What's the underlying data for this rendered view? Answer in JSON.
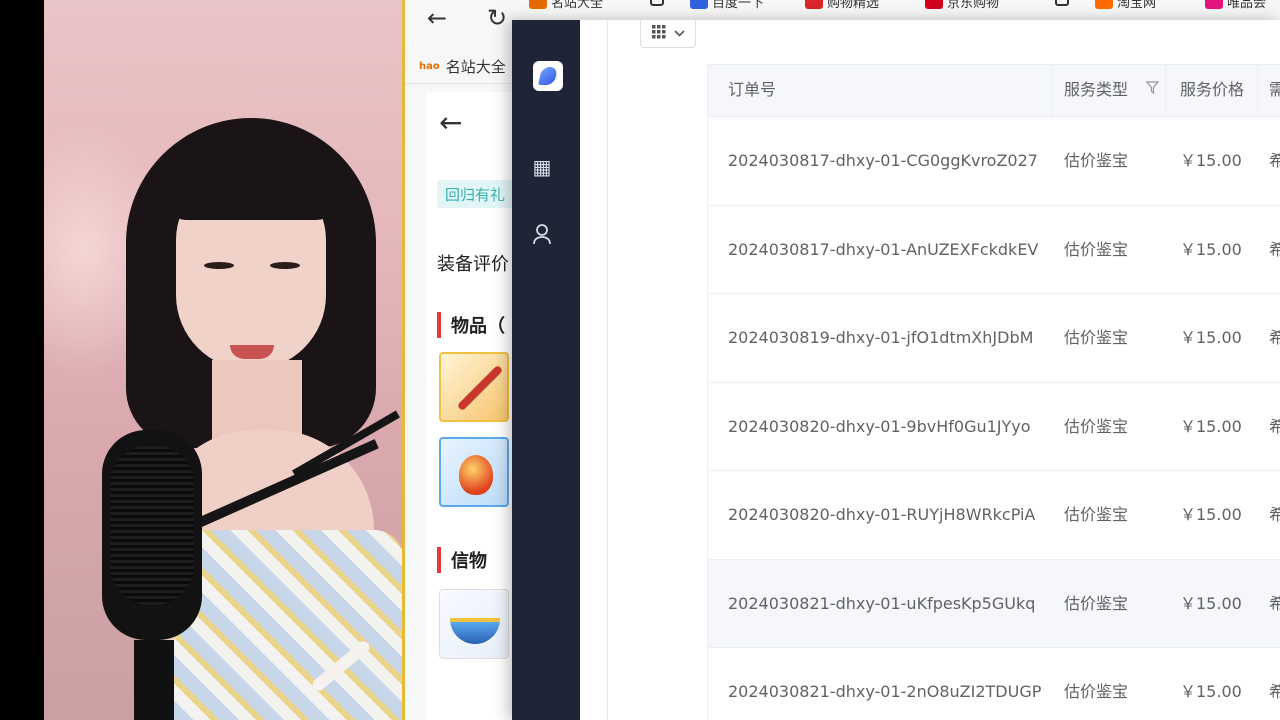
{
  "browser": {
    "bookmark_label": "名站大全",
    "bookmark_badge": "hao",
    "top_strip": [
      "名站大全",
      "百度一下",
      "购物精选",
      "京东购物",
      "淘宝网",
      "唯品会"
    ],
    "mobile_page": {
      "tag": "回归有礼",
      "heading": "装备评价",
      "section_items": "物品（",
      "section_tokens": "信物"
    }
  },
  "app": {
    "nav_icons": [
      "app-logo-icon",
      "building-icon",
      "user-icon"
    ],
    "table": {
      "columns": [
        "订单号",
        "服务类型",
        "服务价格",
        "需求描述"
      ],
      "rows": [
        {
          "order_id": "2024030817-dhxy-01-CG0ggKvroZ027",
          "service_type": "估价鉴宝",
          "price": "￥15.00",
          "desc": "希望对[混元"
        },
        {
          "order_id": "2024030817-dhxy-01-AnUZEXFckdkEV",
          "service_type": "估价鉴宝",
          "price": "￥15.00",
          "desc": "希望对[虎头"
        },
        {
          "order_id": "2024030819-dhxy-01-jfO1dtmXhJDbM",
          "service_type": "估价鉴宝",
          "price": "￥15.00",
          "desc": "希望对[狐美"
        },
        {
          "order_id": "2024030820-dhxy-01-9bvHf0Gu1JYyo",
          "service_type": "估价鉴宝",
          "price": "￥15.00",
          "desc": "希望对[飞剑"
        },
        {
          "order_id": "2024030820-dhxy-01-RUYjH8WRkcPiA",
          "service_type": "估价鉴宝",
          "price": "￥15.00",
          "desc": "希望对[骊珠"
        },
        {
          "order_id": "2024030821-dhxy-01-uKfpesKp5GUkq",
          "service_type": "估价鉴宝",
          "price": "￥15.00",
          "desc": "希望对[木天"
        },
        {
          "order_id": "2024030821-dhxy-01-2nO8uZI2TDUGP",
          "service_type": "估价鉴宝",
          "price": "￥15.00",
          "desc": "希望对[飞剑"
        }
      ]
    }
  }
}
